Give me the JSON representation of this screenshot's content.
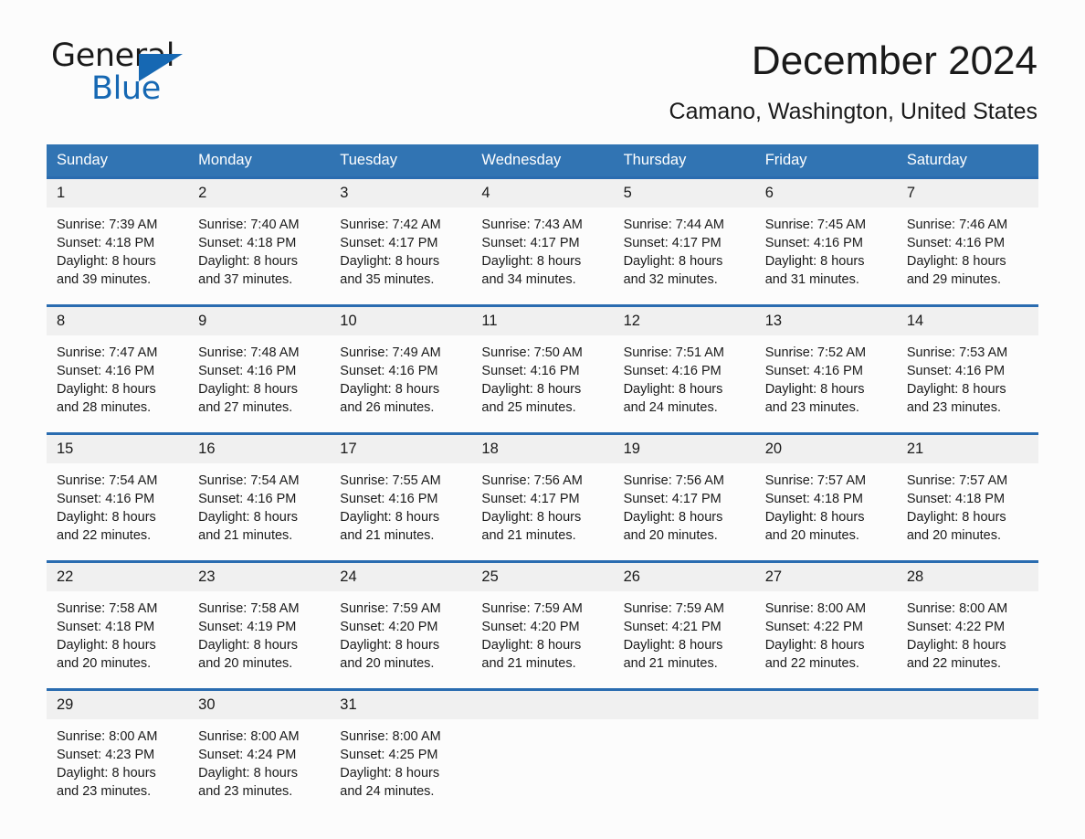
{
  "brand": {
    "name_part1": "General",
    "name_part2": "Blue",
    "accent_color": "#1668b3"
  },
  "header": {
    "month_title": "December 2024",
    "location": "Camano, Washington, United States"
  },
  "theme": {
    "header_blue": "#3174b3",
    "row_divider_blue": "#2a6cb0",
    "date_band_gray": "#f0f0f0",
    "page_background": "#fcfcfc",
    "text_color": "#1a1a1a"
  },
  "calendar": {
    "weekday_headers": [
      "Sunday",
      "Monday",
      "Tuesday",
      "Wednesday",
      "Thursday",
      "Friday",
      "Saturday"
    ],
    "weeks": [
      {
        "days": [
          {
            "date": "1",
            "sunrise": "Sunrise: 7:39 AM",
            "sunset": "Sunset: 4:18 PM",
            "daylight_line1": "Daylight: 8 hours",
            "daylight_line2": "and 39 minutes."
          },
          {
            "date": "2",
            "sunrise": "Sunrise: 7:40 AM",
            "sunset": "Sunset: 4:18 PM",
            "daylight_line1": "Daylight: 8 hours",
            "daylight_line2": "and 37 minutes."
          },
          {
            "date": "3",
            "sunrise": "Sunrise: 7:42 AM",
            "sunset": "Sunset: 4:17 PM",
            "daylight_line1": "Daylight: 8 hours",
            "daylight_line2": "and 35 minutes."
          },
          {
            "date": "4",
            "sunrise": "Sunrise: 7:43 AM",
            "sunset": "Sunset: 4:17 PM",
            "daylight_line1": "Daylight: 8 hours",
            "daylight_line2": "and 34 minutes."
          },
          {
            "date": "5",
            "sunrise": "Sunrise: 7:44 AM",
            "sunset": "Sunset: 4:17 PM",
            "daylight_line1": "Daylight: 8 hours",
            "daylight_line2": "and 32 minutes."
          },
          {
            "date": "6",
            "sunrise": "Sunrise: 7:45 AM",
            "sunset": "Sunset: 4:16 PM",
            "daylight_line1": "Daylight: 8 hours",
            "daylight_line2": "and 31 minutes."
          },
          {
            "date": "7",
            "sunrise": "Sunrise: 7:46 AM",
            "sunset": "Sunset: 4:16 PM",
            "daylight_line1": "Daylight: 8 hours",
            "daylight_line2": "and 29 minutes."
          }
        ]
      },
      {
        "days": [
          {
            "date": "8",
            "sunrise": "Sunrise: 7:47 AM",
            "sunset": "Sunset: 4:16 PM",
            "daylight_line1": "Daylight: 8 hours",
            "daylight_line2": "and 28 minutes."
          },
          {
            "date": "9",
            "sunrise": "Sunrise: 7:48 AM",
            "sunset": "Sunset: 4:16 PM",
            "daylight_line1": "Daylight: 8 hours",
            "daylight_line2": "and 27 minutes."
          },
          {
            "date": "10",
            "sunrise": "Sunrise: 7:49 AM",
            "sunset": "Sunset: 4:16 PM",
            "daylight_line1": "Daylight: 8 hours",
            "daylight_line2": "and 26 minutes."
          },
          {
            "date": "11",
            "sunrise": "Sunrise: 7:50 AM",
            "sunset": "Sunset: 4:16 PM",
            "daylight_line1": "Daylight: 8 hours",
            "daylight_line2": "and 25 minutes."
          },
          {
            "date": "12",
            "sunrise": "Sunrise: 7:51 AM",
            "sunset": "Sunset: 4:16 PM",
            "daylight_line1": "Daylight: 8 hours",
            "daylight_line2": "and 24 minutes."
          },
          {
            "date": "13",
            "sunrise": "Sunrise: 7:52 AM",
            "sunset": "Sunset: 4:16 PM",
            "daylight_line1": "Daylight: 8 hours",
            "daylight_line2": "and 23 minutes."
          },
          {
            "date": "14",
            "sunrise": "Sunrise: 7:53 AM",
            "sunset": "Sunset: 4:16 PM",
            "daylight_line1": "Daylight: 8 hours",
            "daylight_line2": "and 23 minutes."
          }
        ]
      },
      {
        "days": [
          {
            "date": "15",
            "sunrise": "Sunrise: 7:54 AM",
            "sunset": "Sunset: 4:16 PM",
            "daylight_line1": "Daylight: 8 hours",
            "daylight_line2": "and 22 minutes."
          },
          {
            "date": "16",
            "sunrise": "Sunrise: 7:54 AM",
            "sunset": "Sunset: 4:16 PM",
            "daylight_line1": "Daylight: 8 hours",
            "daylight_line2": "and 21 minutes."
          },
          {
            "date": "17",
            "sunrise": "Sunrise: 7:55 AM",
            "sunset": "Sunset: 4:16 PM",
            "daylight_line1": "Daylight: 8 hours",
            "daylight_line2": "and 21 minutes."
          },
          {
            "date": "18",
            "sunrise": "Sunrise: 7:56 AM",
            "sunset": "Sunset: 4:17 PM",
            "daylight_line1": "Daylight: 8 hours",
            "daylight_line2": "and 21 minutes."
          },
          {
            "date": "19",
            "sunrise": "Sunrise: 7:56 AM",
            "sunset": "Sunset: 4:17 PM",
            "daylight_line1": "Daylight: 8 hours",
            "daylight_line2": "and 20 minutes."
          },
          {
            "date": "20",
            "sunrise": "Sunrise: 7:57 AM",
            "sunset": "Sunset: 4:18 PM",
            "daylight_line1": "Daylight: 8 hours",
            "daylight_line2": "and 20 minutes."
          },
          {
            "date": "21",
            "sunrise": "Sunrise: 7:57 AM",
            "sunset": "Sunset: 4:18 PM",
            "daylight_line1": "Daylight: 8 hours",
            "daylight_line2": "and 20 minutes."
          }
        ]
      },
      {
        "days": [
          {
            "date": "22",
            "sunrise": "Sunrise: 7:58 AM",
            "sunset": "Sunset: 4:18 PM",
            "daylight_line1": "Daylight: 8 hours",
            "daylight_line2": "and 20 minutes."
          },
          {
            "date": "23",
            "sunrise": "Sunrise: 7:58 AM",
            "sunset": "Sunset: 4:19 PM",
            "daylight_line1": "Daylight: 8 hours",
            "daylight_line2": "and 20 minutes."
          },
          {
            "date": "24",
            "sunrise": "Sunrise: 7:59 AM",
            "sunset": "Sunset: 4:20 PM",
            "daylight_line1": "Daylight: 8 hours",
            "daylight_line2": "and 20 minutes."
          },
          {
            "date": "25",
            "sunrise": "Sunrise: 7:59 AM",
            "sunset": "Sunset: 4:20 PM",
            "daylight_line1": "Daylight: 8 hours",
            "daylight_line2": "and 21 minutes."
          },
          {
            "date": "26",
            "sunrise": "Sunrise: 7:59 AM",
            "sunset": "Sunset: 4:21 PM",
            "daylight_line1": "Daylight: 8 hours",
            "daylight_line2": "and 21 minutes."
          },
          {
            "date": "27",
            "sunrise": "Sunrise: 8:00 AM",
            "sunset": "Sunset: 4:22 PM",
            "daylight_line1": "Daylight: 8 hours",
            "daylight_line2": "and 22 minutes."
          },
          {
            "date": "28",
            "sunrise": "Sunrise: 8:00 AM",
            "sunset": "Sunset: 4:22 PM",
            "daylight_line1": "Daylight: 8 hours",
            "daylight_line2": "and 22 minutes."
          }
        ]
      },
      {
        "days": [
          {
            "date": "29",
            "sunrise": "Sunrise: 8:00 AM",
            "sunset": "Sunset: 4:23 PM",
            "daylight_line1": "Daylight: 8 hours",
            "daylight_line2": "and 23 minutes."
          },
          {
            "date": "30",
            "sunrise": "Sunrise: 8:00 AM",
            "sunset": "Sunset: 4:24 PM",
            "daylight_line1": "Daylight: 8 hours",
            "daylight_line2": "and 23 minutes."
          },
          {
            "date": "31",
            "sunrise": "Sunrise: 8:00 AM",
            "sunset": "Sunset: 4:25 PM",
            "daylight_line1": "Daylight: 8 hours",
            "daylight_line2": "and 24 minutes."
          },
          {
            "date": "",
            "sunrise": "",
            "sunset": "",
            "daylight_line1": "",
            "daylight_line2": ""
          },
          {
            "date": "",
            "sunrise": "",
            "sunset": "",
            "daylight_line1": "",
            "daylight_line2": ""
          },
          {
            "date": "",
            "sunrise": "",
            "sunset": "",
            "daylight_line1": "",
            "daylight_line2": ""
          },
          {
            "date": "",
            "sunrise": "",
            "sunset": "",
            "daylight_line1": "",
            "daylight_line2": ""
          }
        ]
      }
    ]
  }
}
